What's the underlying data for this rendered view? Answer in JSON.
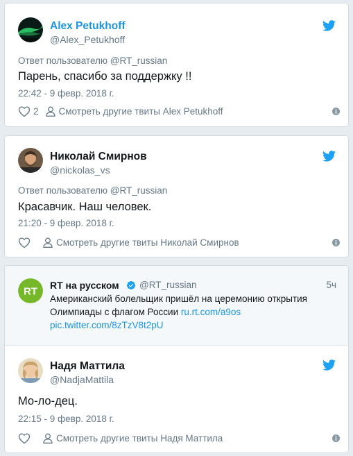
{
  "colors": {
    "background": "#e6ecf0",
    "twitter_blue": "#1da1f2",
    "link_blue": "#1b95e0",
    "secondary_text": "#657786",
    "rt_green": "#77b82a"
  },
  "icons": {
    "brand": "twitter-bird-icon",
    "like": "heart-icon",
    "profile": "person-icon",
    "info": "info-icon",
    "verified": "verified-badge-icon"
  },
  "tweets": [
    {
      "name": "Alex Petukhoff",
      "handle": "@Alex_Petukhoff",
      "reply_to": "Ответ пользователю @RT_russian",
      "text": "Парень, спасибо за поддержку !!",
      "date": "22:42 - 9 февр. 2018 г.",
      "likes": "2",
      "more": "Смотреть другие твиты Alex Petukhoff"
    },
    {
      "name": "Николай Смирнов",
      "handle": "@nickolas_vs",
      "reply_to": "Ответ пользователю @RT_russian",
      "text": "Красавчик. Наш человек.",
      "date": "21:20 - 9 февр. 2018 г.",
      "more": "Смотреть другие твиты Николай Смирнов"
    },
    {
      "quoted": {
        "name": "RT на русском",
        "handle": "@RT_russian",
        "time": "5ч",
        "text_line1": "Американский болельщик пришёл на церемонию открытия",
        "text_line2": "Олимпиады с флагом России ",
        "link1": "ru.rt.com/a9os",
        "link2": "pic.twitter.com/8zTzV8t2pU",
        "avatar_text": "RT"
      },
      "name": "Надя Маттила",
      "handle": "@NadjaMattila",
      "text": "Мо-ло-дец.",
      "date": "22:15 - 9 февр. 2018 г.",
      "more": "Смотреть другие твиты Надя Маттила"
    }
  ]
}
